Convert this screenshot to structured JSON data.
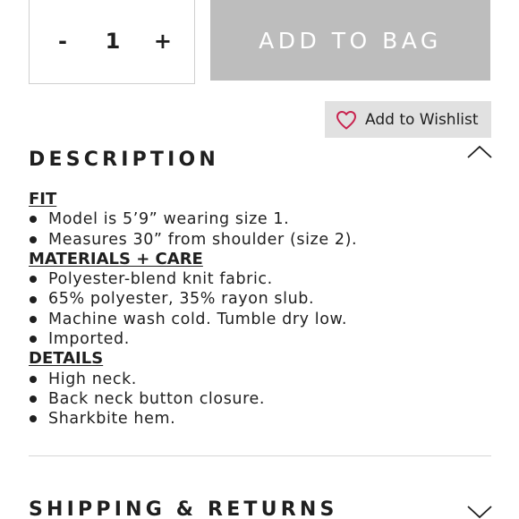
{
  "quantity": {
    "decrement_label": "-",
    "value": "1",
    "increment_label": "+"
  },
  "add_to_bag": {
    "label": "ADD TO BAG"
  },
  "wishlist": {
    "label": "Add to Wishlist",
    "icon": "heart-outline-icon",
    "icon_color": "#c8234f"
  },
  "description": {
    "title": "DESCRIPTION",
    "expanded": true,
    "groups": [
      {
        "heading": "FIT",
        "items": [
          "Model is 5’9” wearing size 1.",
          "Measures 30” from shoulder (size 2)."
        ]
      },
      {
        "heading": "MATERIALS + CARE",
        "items": [
          "Polyester-blend knit fabric.",
          "65% polyester, 35% rayon slub.",
          "Machine wash cold. Tumble dry low.",
          "Imported."
        ]
      },
      {
        "heading": "DETAILS",
        "items": [
          "High neck.",
          "Back neck button closure.",
          "Sharkbite hem."
        ]
      }
    ]
  },
  "shipping": {
    "title": "SHIPPING & RETURNS",
    "expanded": false
  },
  "colors": {
    "button_disabled": "#bdbdbd",
    "wishlist_bg": "#e1e1e1",
    "text": "#1f1f1f",
    "heart": "#c8234f"
  }
}
